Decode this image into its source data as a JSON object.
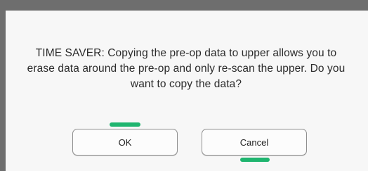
{
  "dialog": {
    "message": "TIME SAVER: Copying the pre-op data to upper allows you to erase data around the pre-op and only re-scan the upper. Do you want to copy the data?",
    "ok_label": "OK",
    "cancel_label": "Cancel"
  },
  "colors": {
    "backdrop": "#6e6e6e",
    "dialog_background": "#f7f7f7",
    "marker_green": "#1fb56f"
  }
}
